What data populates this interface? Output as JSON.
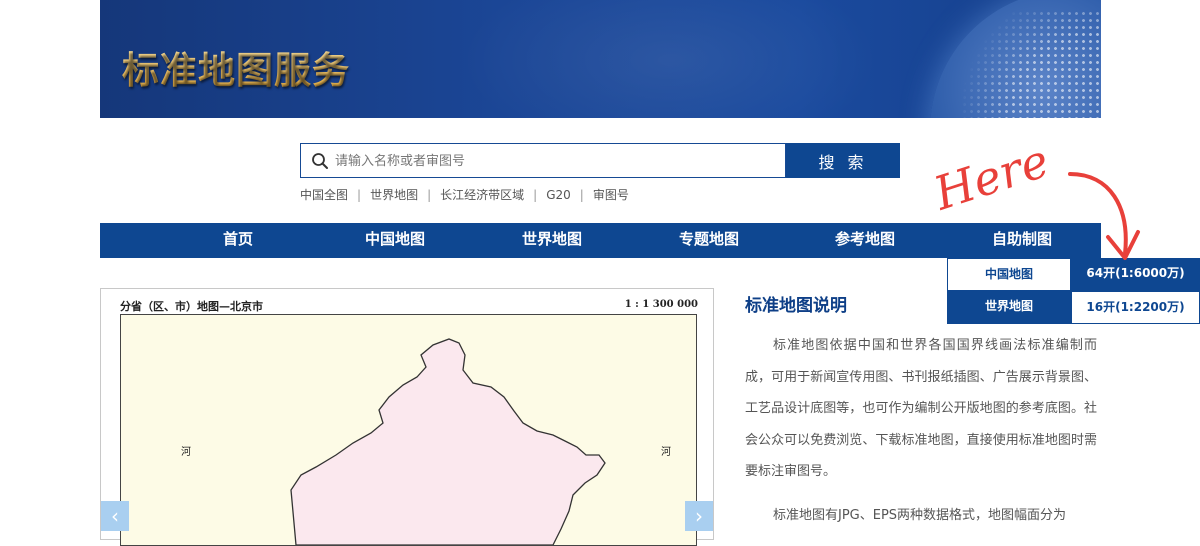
{
  "banner": {
    "title": "标准地图服务"
  },
  "search": {
    "placeholder": "请输入名称或者审图号",
    "button_label": "搜 索"
  },
  "quick_links": [
    "中国全图",
    "世界地图",
    "长江经济带区域",
    "G20",
    "审图号"
  ],
  "nav": {
    "items": [
      "首页",
      "中国地图",
      "世界地图",
      "专题地图",
      "参考地图",
      "自助制图"
    ],
    "active": "自助制图"
  },
  "dropdown": {
    "rows": [
      {
        "name": "中国地图",
        "size": "64开(1:6000万)"
      },
      {
        "name": "世界地图",
        "size": "16开(1:2200万)"
      }
    ]
  },
  "annotation": {
    "text": "Here",
    "color": "#e8403a"
  },
  "map": {
    "title": "分省（区、市）地图—北京市",
    "scale": "1 : 1 300 000",
    "labels": [
      "河",
      "河"
    ],
    "prev_label": "‹",
    "next_label": "›"
  },
  "description": {
    "title": "标准地图说明",
    "paragraph1": "标准地图依据中国和世界各国国界线画法标准编制而成，可用于新闻宣传用图、书刊报纸插图、广告展示背景图、工艺品设计底图等，也可作为编制公开版地图的参考底图。社会公众可以免费浏览、下载标准地图，直接使用标准地图时需要标注审图号。",
    "paragraph2": "标准地图有JPG、EPS两种数据格式，地图幅面分为"
  },
  "colors": {
    "primary": "#0e4791",
    "title_blue": "#0e3f87",
    "banner_gold": "#e8b84c",
    "map_bg": "#fdfbe6",
    "region_fill": "#fbe8ee"
  }
}
